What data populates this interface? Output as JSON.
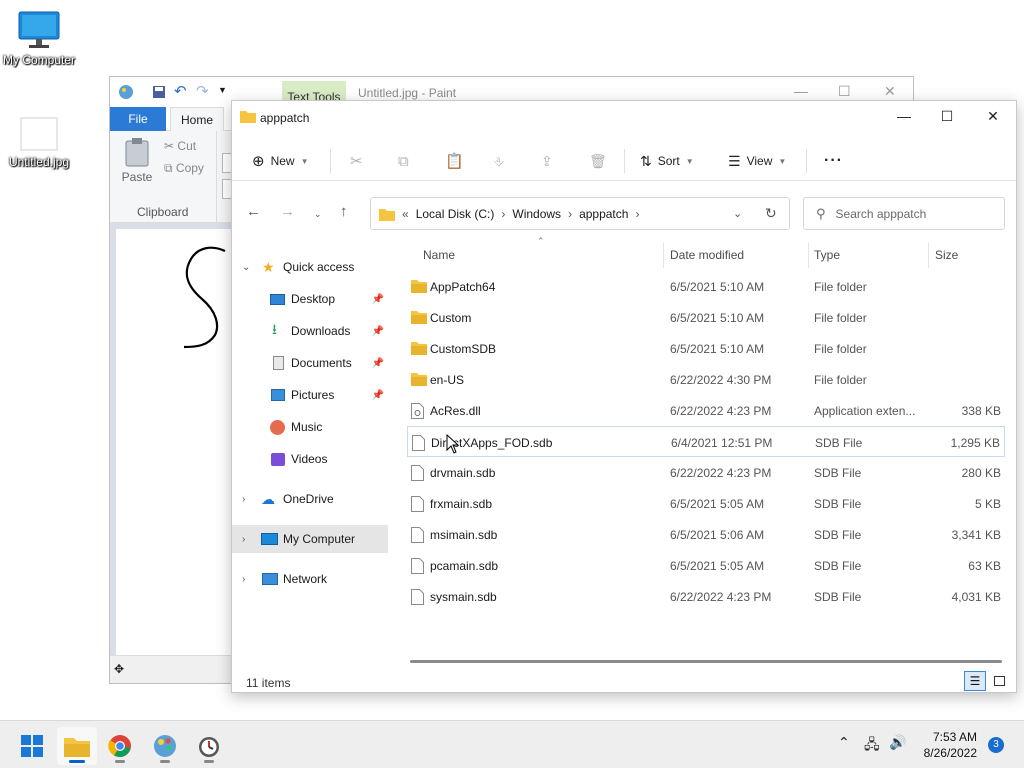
{
  "desktop": {
    "icons": [
      {
        "label": "My Computer"
      },
      {
        "label": "Untitled.jpg"
      }
    ]
  },
  "paint": {
    "context_tab": "Text Tools",
    "title": "Untitled.jpg - Paint",
    "file_tab": "File",
    "home_tab": "Home",
    "paste_label": "Paste",
    "cut_label": "Cut",
    "copy_label": "Copy",
    "clipboard_label": "Clipboard"
  },
  "explorer": {
    "title": "apppatch",
    "toolbar": {
      "new": "New",
      "sort": "Sort",
      "view": "View"
    },
    "address": {
      "crumbs": [
        "Local Disk (C:)",
        "Windows",
        "apppatch"
      ]
    },
    "search_placeholder": "Search apppatch",
    "nav": {
      "quick_access": "Quick access",
      "pinned": [
        "Desktop",
        "Downloads",
        "Documents",
        "Pictures"
      ],
      "unpinned": [
        "Music",
        "Videos"
      ],
      "onedrive": "OneDrive",
      "my_computer": "My Computer",
      "network": "Network"
    },
    "columns": {
      "name": "Name",
      "date": "Date modified",
      "type": "Type",
      "size": "Size"
    },
    "files": [
      {
        "name": "AppPatch64",
        "date": "6/5/2021 5:10 AM",
        "type": "File folder",
        "size": "",
        "kind": "folder"
      },
      {
        "name": "Custom",
        "date": "6/5/2021 5:10 AM",
        "type": "File folder",
        "size": "",
        "kind": "folder"
      },
      {
        "name": "CustomSDB",
        "date": "6/5/2021 5:10 AM",
        "type": "File folder",
        "size": "",
        "kind": "folder"
      },
      {
        "name": "en-US",
        "date": "6/22/2022 4:30 PM",
        "type": "File folder",
        "size": "",
        "kind": "folder"
      },
      {
        "name": "AcRes.dll",
        "date": "6/22/2022 4:23 PM",
        "type": "Application exten...",
        "size": "338 KB",
        "kind": "dll"
      },
      {
        "name": "DirectXApps_FOD.sdb",
        "date": "6/4/2021 12:51 PM",
        "type": "SDB File",
        "size": "1,295 KB",
        "kind": "file"
      },
      {
        "name": "drvmain.sdb",
        "date": "6/22/2022 4:23 PM",
        "type": "SDB File",
        "size": "280 KB",
        "kind": "file"
      },
      {
        "name": "frxmain.sdb",
        "date": "6/5/2021 5:05 AM",
        "type": "SDB File",
        "size": "5 KB",
        "kind": "file"
      },
      {
        "name": "msimain.sdb",
        "date": "6/5/2021 5:06 AM",
        "type": "SDB File",
        "size": "3,341 KB",
        "kind": "file"
      },
      {
        "name": "pcamain.sdb",
        "date": "6/5/2021 5:05 AM",
        "type": "SDB File",
        "size": "63 KB",
        "kind": "file"
      },
      {
        "name": "sysmain.sdb",
        "date": "6/22/2022 4:23 PM",
        "type": "SDB File",
        "size": "4,031 KB",
        "kind": "file"
      }
    ],
    "status": "11 items"
  },
  "taskbar": {
    "time": "7:53 AM",
    "date": "8/26/2022",
    "notifications": "3"
  },
  "colors": {
    "accent": "#0a62c4",
    "folder": "#f5c542",
    "file_tab": "#2b7bd6",
    "context_tab": "#d9ecc5"
  }
}
